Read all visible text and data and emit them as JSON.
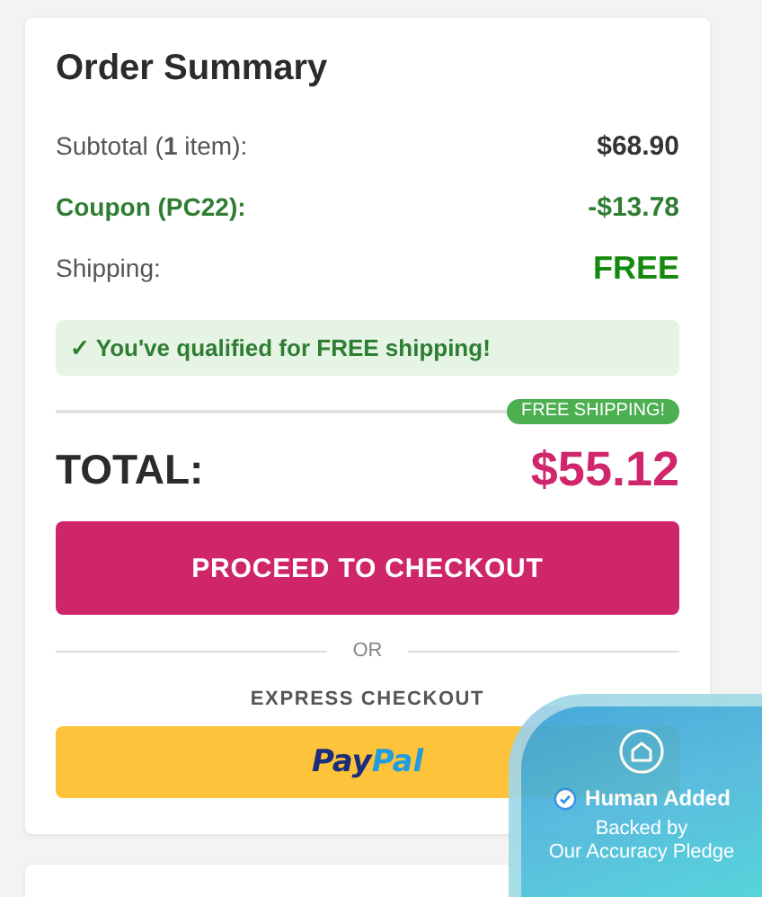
{
  "order_summary": {
    "title": "Order Summary",
    "lines": [
      {
        "kind": "plain",
        "label": "Subtotal (**1** item):",
        "value": "$68.90"
      },
      {
        "kind": "discount",
        "label": "Coupon (PC22):",
        "value": "-$13.78"
      },
      {
        "kind": "shipping",
        "label": "Shipping:",
        "value": "FREE"
      }
    ],
    "notice": "✓ You've qualified for FREE shipping!",
    "badge": "FREE SHIPPING!",
    "total": {
      "label": "TOTAL:",
      "value": "$55.12"
    },
    "checkout_button": "PROCEED TO CHECKOUT",
    "separator": "OR",
    "express_label": "EXPRESS CHECKOUT",
    "paypal_logo": [
      "Pay",
      "Pal"
    ]
  },
  "trust_badge": {
    "title": "Human Added",
    "subtitle": "Backed by\nOur Accuracy Pledge"
  }
}
